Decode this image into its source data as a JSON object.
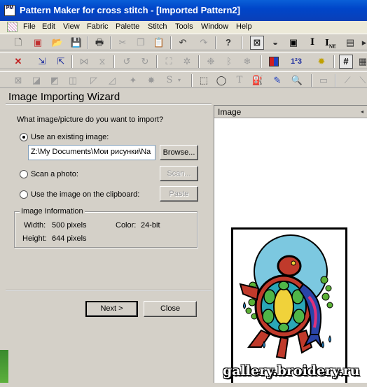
{
  "window": {
    "title": "Pattern Maker for cross stitch - [Imported Pattern2]",
    "icon_text": "PM"
  },
  "menu": [
    "File",
    "Edit",
    "View",
    "Fabric",
    "Palette",
    "Stitch",
    "Tools",
    "Window",
    "Help"
  ],
  "toolbar": {
    "ne_label": "NE"
  },
  "wizard": {
    "title": "Image Importing Wizard",
    "question": "What image/picture do you want to import?",
    "opt_existing": "Use an existing image:",
    "file_path": "Z:\\My Documents\\Мои рисунки\\Na",
    "browse": "Browse...",
    "opt_scan": "Scan a photo:",
    "scan": "Scan...",
    "opt_clipboard": "Use the image on the clipboard:",
    "paste": "Paste",
    "info_group": "Image Information",
    "width_label": "Width:",
    "width_value": "500 pixels",
    "height_label": "Height:",
    "height_value": "644 pixels",
    "color_label": "Color:",
    "color_value": "24-bit",
    "next": "Next >",
    "close": "Close"
  },
  "image_panel": {
    "header": "Image"
  },
  "watermark": "gallery.broidery.ru"
}
